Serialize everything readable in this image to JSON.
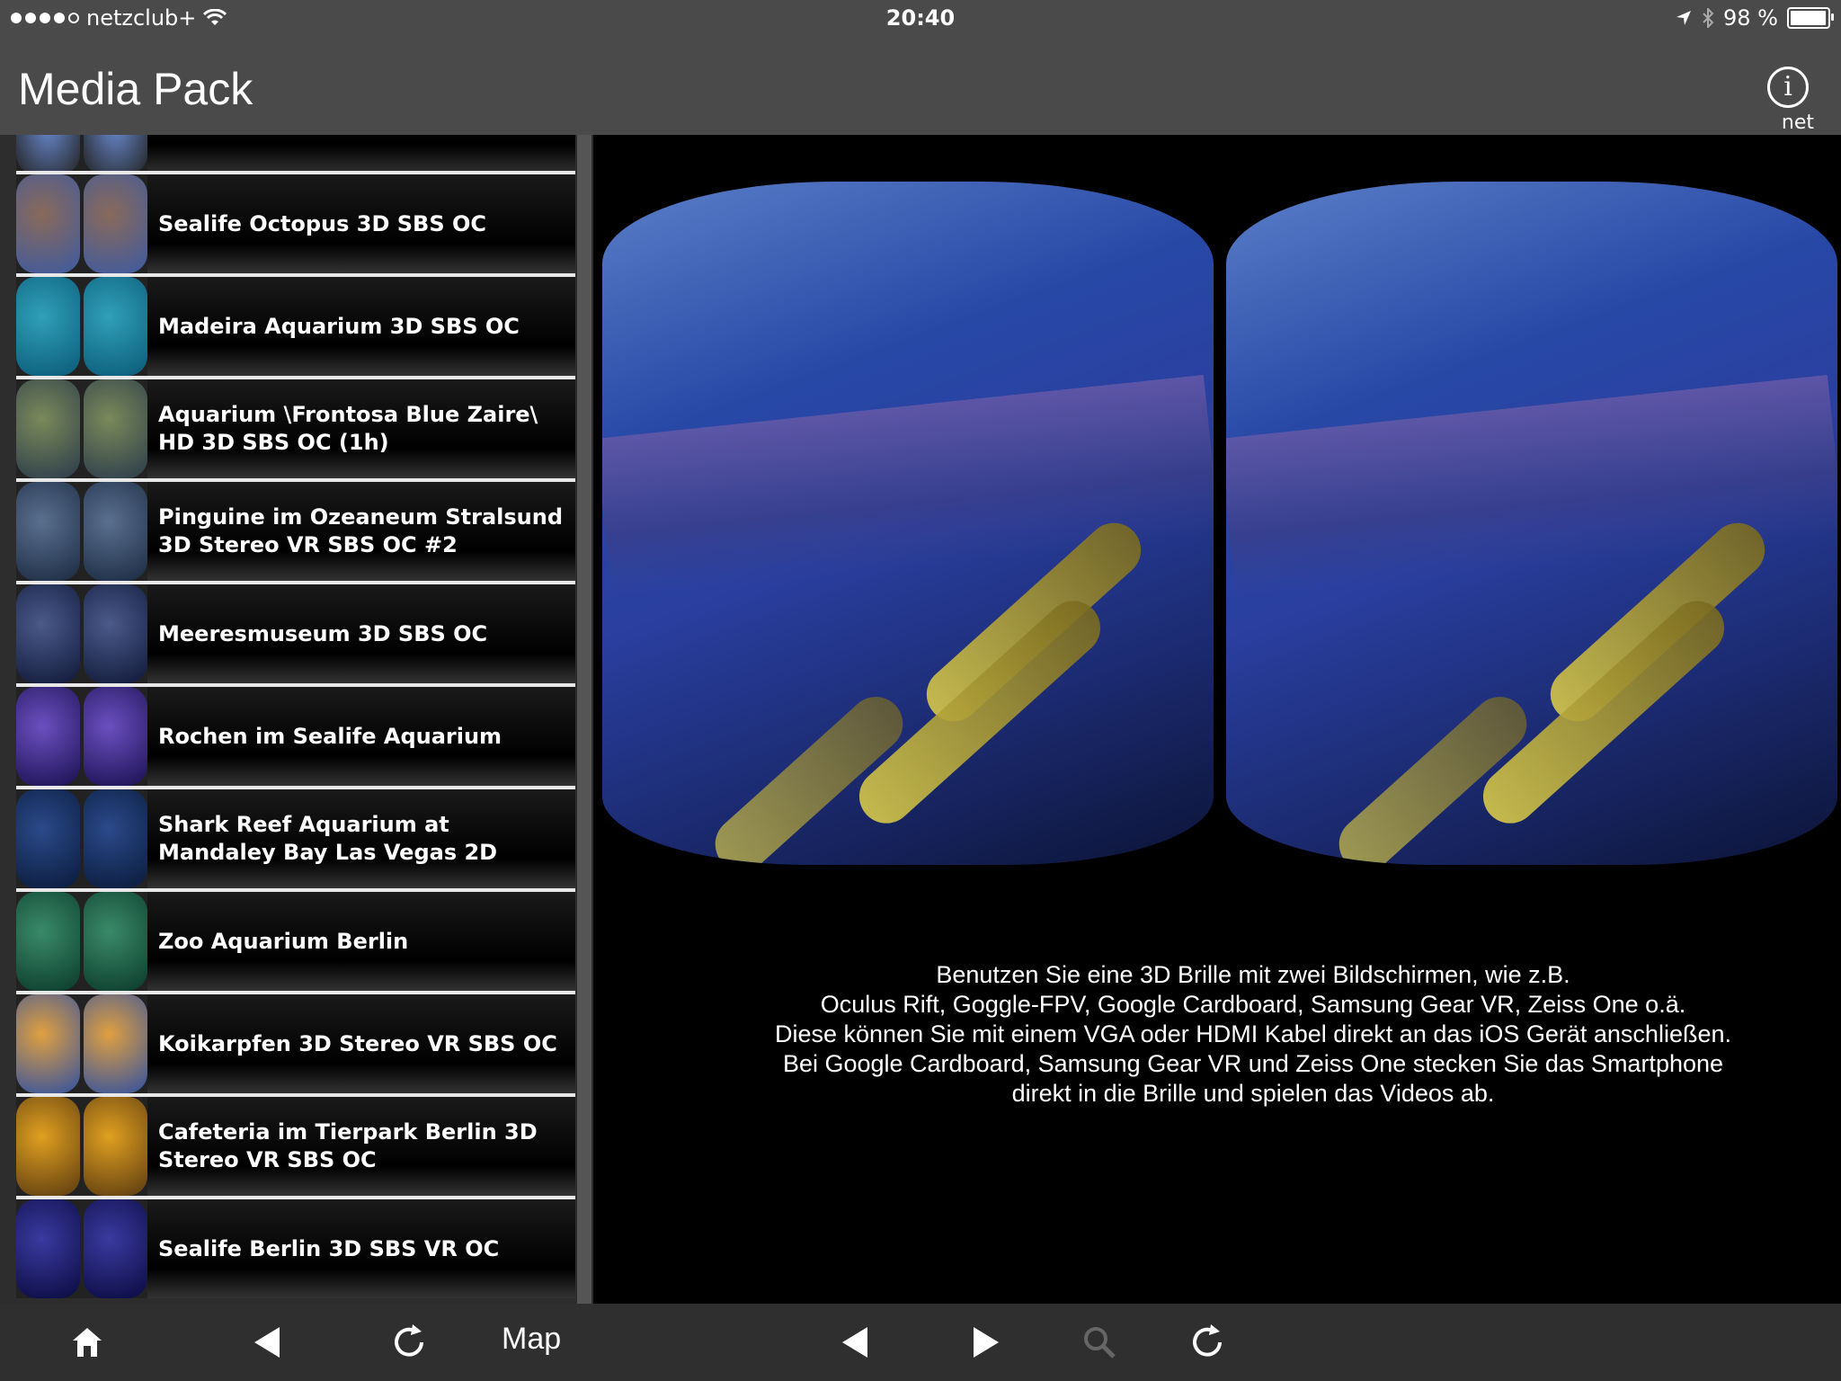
{
  "status_bar": {
    "carrier": "netzclub+",
    "time": "20:40",
    "battery": "98 %",
    "battery_level": 0.98
  },
  "nav": {
    "title": "Media Pack",
    "info_label": "net"
  },
  "list": {
    "items": [
      {
        "label": "Sealife Octopus 3D SBS OC"
      },
      {
        "label": "Madeira Aquarium 3D SBS OC"
      },
      {
        "label": "Aquarium \\Frontosa Blue Zaire\\ HD 3D SBS OC (1h)"
      },
      {
        "label": "Pinguine im Ozeaneum Stralsund 3D Stereo VR SBS OC #2"
      },
      {
        "label": "Meeresmuseum 3D SBS OC"
      },
      {
        "label": "Rochen im Sealife Aquarium"
      },
      {
        "label": "Shark Reef Aquarium at Mandaley Bay Las Vegas 2D"
      },
      {
        "label": "Zoo Aquarium Berlin"
      },
      {
        "label": "Koikarpfen 3D Stereo VR SBS OC"
      },
      {
        "label": "Cafeteria im Tierpark Berlin 3D Stereo VR SBS OC"
      },
      {
        "label": "Sealife Berlin 3D SBS VR OC"
      }
    ]
  },
  "caption": {
    "line1": "Benutzen Sie eine 3D Brille mit zwei Bildschirmen, wie z.B.",
    "line2": "Oculus Rift, Goggle-FPV, Google Cardboard, Samsung Gear VR, Zeiss One o.ä.",
    "line3": "Diese können Sie mit einem VGA oder HDMI Kabel direkt an das iOS Gerät anschließen.",
    "line4": "Bei Google Cardboard, Samsung Gear VR und Zeiss One stecken Sie das Smartphone",
    "line5": "direkt in die Brille und spielen das Videos ab."
  },
  "toolbar": {
    "map_label": "Map"
  },
  "icons": [
    "home-icon",
    "back-icon",
    "reload-icon",
    "prev-icon",
    "next-icon",
    "search-icon",
    "refresh-icon",
    "info-icon",
    "wifi-icon",
    "location-icon",
    "bluetooth-icon",
    "battery-icon"
  ]
}
